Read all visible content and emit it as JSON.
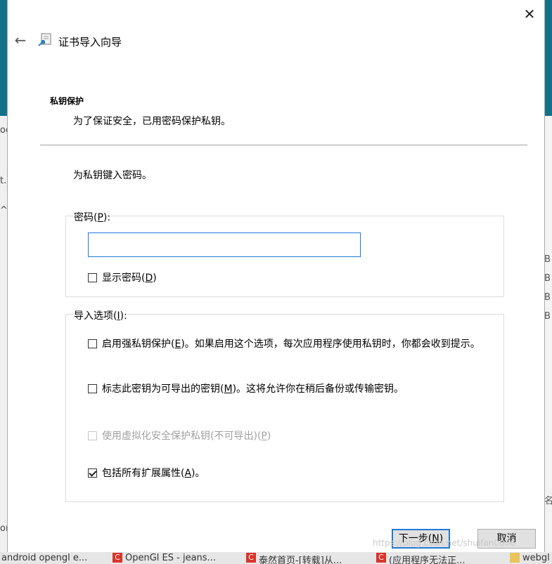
{
  "dialog": {
    "title": "证书导入向导",
    "section_title": "私钥保护",
    "section_desc": "为了保证安全，已用密码保护私钥。",
    "instruction": "为私钥键入密码。",
    "password_group": {
      "label_text": "密码(",
      "label_key": "P",
      "label_end": "):",
      "value": "",
      "show_password": {
        "text": "显示密码(",
        "key": "D",
        "end": ")",
        "checked": false
      }
    },
    "options_group": {
      "label_text": "导入选项(",
      "label_key": "I",
      "label_end": "):",
      "strong_protection": {
        "text": "启用强私钥保护(",
        "key": "E",
        "end": ")。如果启用这个选项，每次应用程序使用私钥时，你都会收到提示。",
        "checked": false
      },
      "exportable": {
        "text": "标志此密钥为可导出的密钥(",
        "key": "M",
        "end": ")。这将允许你在稍后备份或传输密钥。",
        "checked": false
      },
      "virtualization": {
        "text": "使用虚拟化安全保护私钥(不可导出)(",
        "key": "P",
        "end": ")",
        "checked": false,
        "disabled": true
      },
      "extended_props": {
        "text": "包括所有扩展属性(",
        "key": "A",
        "end": ")。",
        "checked": true
      }
    },
    "next_button": {
      "text": "下一步(",
      "key": "N",
      "end": ")"
    },
    "cancel_label": "取消",
    "close_glyph": "✕",
    "back_glyph": "←"
  },
  "background": {
    "left_fragments": [
      "oo",
      "t.",
      "^",
      "or"
    ],
    "right_letters": [
      "B",
      "B",
      "B",
      "B"
    ],
    "right_bottom": "名"
  },
  "taskbar": {
    "items": [
      "android opengl e...",
      "OpenGl ES - jeans...",
      "泰然首页-[转载]从...",
      "(应用程序无法正...",
      "webgl"
    ]
  },
  "watermark": "https://blog.csdn.net/shuifan0086",
  "colors": {
    "accent": "#1f7ad8",
    "teal": "#14718a"
  }
}
